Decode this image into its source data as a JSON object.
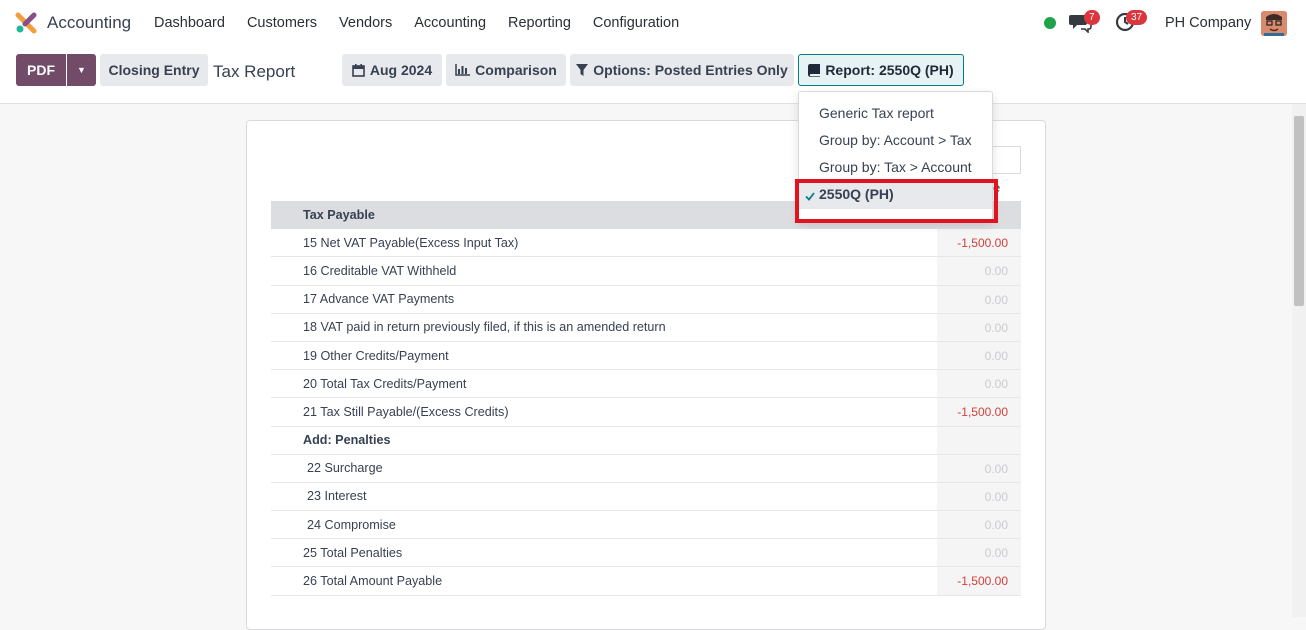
{
  "nav": {
    "app_name": "Accounting",
    "menu": [
      "Dashboard",
      "Customers",
      "Vendors",
      "Accounting",
      "Reporting",
      "Configuration"
    ],
    "chat_badge": "7",
    "activity_badge": "37",
    "company": "PH Company"
  },
  "toolbar": {
    "pdf_label": "PDF",
    "closing_label": "Closing Entry",
    "title": "Tax Report",
    "date_label": "Aug 2024",
    "comparison_label": "Comparison",
    "options_label": "Options: Posted Entries Only",
    "report_label": "Report: 2550Q (PH)"
  },
  "dropdown": {
    "items": [
      "Generic Tax report",
      "Group by: Account > Tax",
      "Group by: Tax > Account",
      "2550Q (PH)"
    ],
    "selected_index": 3
  },
  "column_fragment": "e",
  "rows": [
    {
      "label": "Tax Payable",
      "value": "",
      "style": "head"
    },
    {
      "label": "15 Net VAT Payable(Excess Input Tax)",
      "value": "-1,500.00",
      "style": "neg"
    },
    {
      "label": "16 Creditable VAT Withheld",
      "value": "0.00",
      "style": "zero"
    },
    {
      "label": "17 Advance VAT Payments",
      "value": "0.00",
      "style": "zero"
    },
    {
      "label": "18 VAT paid in return previously filed, if this is an amended return",
      "value": "0.00",
      "style": "zero"
    },
    {
      "label": "19 Other Credits/Payment",
      "value": "0.00",
      "style": "zero"
    },
    {
      "label": "20 Total Tax Credits/Payment",
      "value": "0.00",
      "style": "zero"
    },
    {
      "label": "21 Tax Still Payable/(Excess Credits)",
      "value": "-1,500.00",
      "style": "neg"
    },
    {
      "label": "Add: Penalties",
      "value": "",
      "style": "bold"
    },
    {
      "label": "22 Surcharge",
      "value": "0.00",
      "style": "indent"
    },
    {
      "label": "23 Interest",
      "value": "0.00",
      "style": "indent"
    },
    {
      "label": "24 Compromise",
      "value": "0.00",
      "style": "indent"
    },
    {
      "label": "25 Total Penalties",
      "value": "0.00",
      "style": "zero"
    },
    {
      "label": "26 Total Amount Payable",
      "value": "-1,500.00",
      "style": "neg"
    }
  ]
}
